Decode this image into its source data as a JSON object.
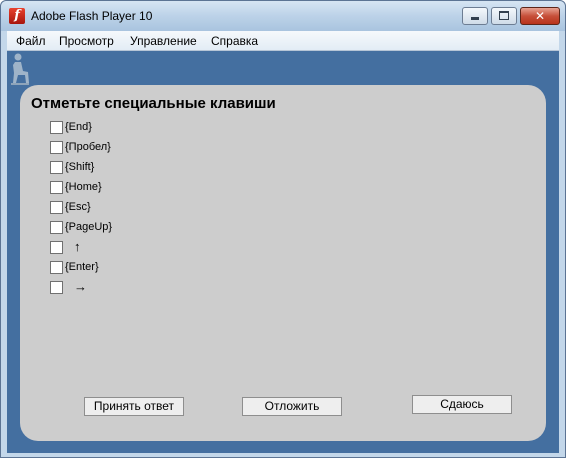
{
  "window": {
    "title": "Adobe Flash Player 10",
    "icon": "flash-icon",
    "controls": [
      "minimize-icon",
      "maximize-icon",
      "close-icon"
    ]
  },
  "menu": {
    "items": [
      {
        "label": "Файл"
      },
      {
        "label": "Просмотр"
      },
      {
        "label": "Управление"
      },
      {
        "label": "Справка"
      }
    ]
  },
  "quiz": {
    "title": "Отметьте специальные клавиши",
    "options": [
      {
        "label": "{End}",
        "checked": false
      },
      {
        "label": "{Пробел}",
        "checked": false
      },
      {
        "label": "{Shift}",
        "checked": false
      },
      {
        "label": "{Home}",
        "checked": false
      },
      {
        "label": "{Esc}",
        "checked": false
      },
      {
        "label": "{PageUp}",
        "checked": false
      },
      {
        "label": "↑",
        "checked": false
      },
      {
        "label": "{Enter}",
        "checked": false
      },
      {
        "label": "→",
        "checked": false
      }
    ],
    "buttons": {
      "accept": "Принять ответ",
      "defer": "Отложить",
      "giveup": "Сдаюсь"
    }
  },
  "colors": {
    "stage_background": "#446fa0",
    "panel_background": "#cdcdcd"
  }
}
